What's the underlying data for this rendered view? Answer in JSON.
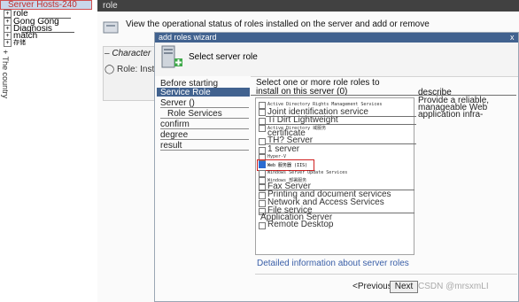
{
  "tree": {
    "selected": "Server Hosts-240",
    "items": [
      "role",
      "Gong Gong",
      "Diagnosis",
      "match",
      "存储"
    ],
    "vertical_text": "+ The country"
  },
  "console": {
    "header": "role",
    "status_text": "View the operational status of roles installed on the server and add or remove",
    "characters_title": "Character",
    "role_installed": "Role: Installed"
  },
  "wizard": {
    "title": "add roles wizard",
    "close": "x",
    "banner_title": "Select server role",
    "nav": [
      "Before starting",
      "Service Role",
      "Server ()",
      "Role Services",
      "confirm",
      "degree",
      "result"
    ],
    "instruction_line1": "Select one or more role roles to",
    "instruction_line2": "install on this server (0)",
    "roles": [
      {
        "label": "Active Directory Rights Management Services",
        "checked": false
      },
      {
        "label": "Joint identification service",
        "checked": false
      },
      {
        "label": "Ti Dirt Lightweight",
        "checked": false
      },
      {
        "label": "Active Directory 域服务",
        "checked": false
      },
      {
        "label": "certificate",
        "checked": false
      },
      {
        "label": "TH? Server",
        "checked": false
      },
      {
        "label": "1 server",
        "checked": false
      },
      {
        "label": "Hyper-V",
        "checked": false
      },
      {
        "label": "Web 服务器 (IIS)",
        "checked": true
      },
      {
        "label": "Windows Server Update Services",
        "checked": false
      },
      {
        "label": "Windows 部署服务",
        "checked": false
      },
      {
        "label": "Fax Server",
        "checked": false
      },
      {
        "label": "Printing and document services",
        "checked": false
      },
      {
        "label": "Network and Access Services",
        "checked": false
      },
      {
        "label": "File service",
        "checked": false
      },
      {
        "label": "Application Server",
        "checked": false
      },
      {
        "label": "Remote Desktop",
        "checked": false
      }
    ],
    "description_head": "describe",
    "description_text": "Provide a reliable, manageable Web application infra-",
    "more_link": "Detailed information about server roles",
    "btn_prev": "<Previous",
    "btn_next": "Next",
    "watermark": "CSDN @mrsxmLI"
  },
  "colors": {
    "title_bar": "#41628f",
    "console_header": "#414141",
    "selection_outline": "#d02020",
    "link": "#3a5fa8"
  }
}
